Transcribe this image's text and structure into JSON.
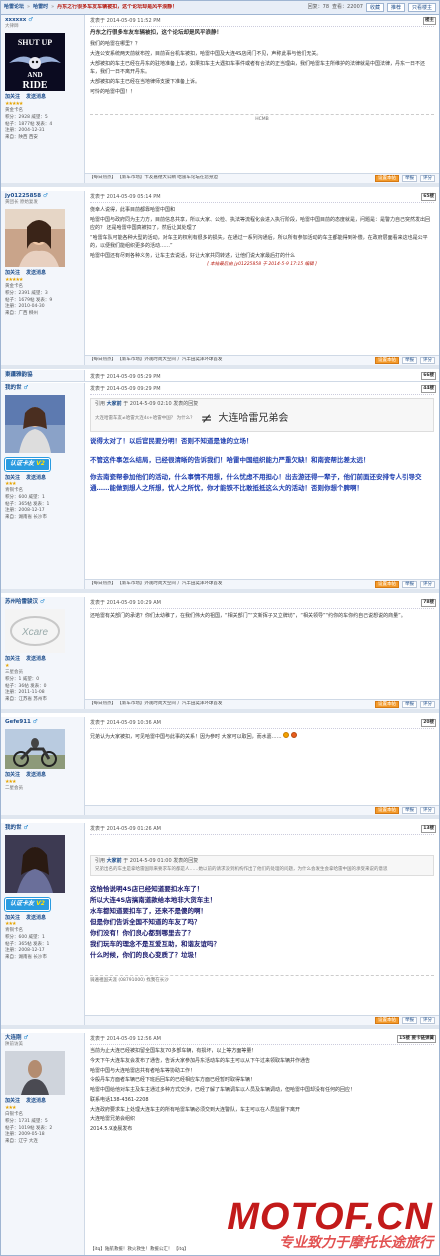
{
  "topbar": {
    "crumb1": "哈雷论坛",
    "crumb2": "哈雷时",
    "title": "丹东之行很多车友车辆被扣，这个论坛却是风平浪静！",
    "stat_label": "回复：",
    "stat_replies": "78",
    "stat_views_label": "查看：",
    "stat_views": "22007",
    "btn_prev": "收藏",
    "btn_next": "推荐",
    "btn_print": "只看楼主"
  },
  "posts": [
    {
      "user": "xxxxxx",
      "gender": "♂",
      "utitle": "大律師",
      "avatar_text": "SHUT UP AND RIDE",
      "actions": [
        "加关注",
        "发送消息"
      ],
      "stars": "★★★★★",
      "rank": "黄金卡名",
      "info": [
        "积分：2928 威望：5",
        "帖子：1877帖 发表：4",
        "注册：2004-12-31",
        "来自：陕西 西安"
      ],
      "date": "发表于 2014-05-09 11:52 PM",
      "floor": "楼主",
      "title": "丹东之行很多车友车辆被扣，这个论坛却是风平浪静！",
      "body": [
        "我们的哈雷在哪里？？",
        "大连公安系统两天前就布控，目前百台机车被扣，哈雷中国及大连4S店闭门不见，声称此事与他们无关。",
        "大部被扣的车主已经在丹东的驻地准备上访，如果扣车主大遇扣车事件或者有合法的正当理由，我们哈雷车主所维护的法律就是中国法律，丹东一日不还车，我们一日不离开丹东。",
        "大部被扣的车主已经在当地律师支援下准备上诉。",
        "可怜的哈雷中国！！"
      ],
      "sig": "HCMB",
      "footer_ad": "【每日热点】 【新车市场】卡友嘉德大公網 哈雷车论坛在您身边",
      "footer_btns": [
        "设置本帖",
        "举报",
        "评分"
      ]
    },
    {
      "user": "jy01225858",
      "gender": "♂",
      "utitle": "黄团长 原始复发",
      "avatar_text": "",
      "actions": [
        "加关注",
        "发送消息"
      ],
      "stars": "★★★★★",
      "rank": "黄金卡名",
      "info": [
        "积分：2391 威望：3",
        "帖子：1679帖 发表：9",
        "注册：2010-04-30",
        "来自：广西 柳州"
      ],
      "date": "发表于 2014-05-09 05:14 PM",
      "floor": "65楼",
      "title": "",
      "body": [
        "侥幸人说得，此事目前都靠哈雷中国和",
        "哈雷中国与政府同为主力方，目前信息共享，所以大家、公检、执法等流程化会进入执行阶段，哈雷中国目前的态度就是，问题是：是警力自己突然发出回应的？ 还是哈雷中国真被扣了，然后让其处理了",
        "“哈雷车队可能各种大型的活动，对车主的权利有很多的损失，在通过一系列沟通后，所以所有参加活动的车主都能得到补偿，在政府层面看来这也是公平的，以便我们能组织更多的活动……”",
        "哈雷中国还有尽到各种义务，让车主去说话，好让大家共同转述，让他们说大家最后打的什么"
      ],
      "edit": "[ 本帖最后由 jy01225858 于 2014-5-9 17:15 编辑 ]",
      "footer_ad": "【每日热点】 【新车市场】外观时尚大空间 广汽丰田奕泽环球首发",
      "footer_btns": [
        "设置本帖",
        "举报",
        "评分"
      ]
    },
    {
      "user": "東疆雅韵協",
      "gender": "",
      "utitle": "",
      "date": "发表于 2014-05-09 05:29 PM",
      "floor": "66楼",
      "collapsed": true
    },
    {
      "user": "我的世",
      "gender": "♂",
      "utitle": "",
      "avatar_text": "",
      "badge": "认证卡友",
      "badge_v": "V2",
      "actions": [
        "加关注",
        "发送消息"
      ],
      "stars": "★★★",
      "rank": "青铜卡名",
      "info": [
        "积分：600 威望：1",
        "帖子：365帖 发表：1",
        "注册：2008-12-17",
        "来自：湖南省 长沙市"
      ],
      "date": "发表于 2014-05-09 09:29 PM",
      "floor": "44楼",
      "quote_head": "大家前",
      "quote_date": "于 2014-5-09 02:10 发表的回复",
      "quote_small": "大连哈雷车友≠哈雷大连4s+哈雷中国？ 为什么？",
      "quote_big": "大连哈雷兄弟会",
      "body_blue": [
        "说得太对了！以后官民要分明！否则不知道是谁的立场！",
        "不管这件事怎么结局，已经很清晰的告诉我们！哈雷中国组织能力严重欠缺！和南瓷帮比差太远！",
        "你去南瓷帮参加他们的活动，什么事情不用想，什么忧虑不用担心！出去游还得一辈子，他们前面还安排专人引导交通……能做到想人之所想，忧人之所忧，你才能铁不比敢抵抵这么大的活动！否则你想个脾啊！"
      ],
      "footer_ad": "【每日热点】 【新车市场】外观时尚大空间 广汽丰田奕泽环球首发",
      "footer_btns": [
        "设置本帖",
        "举报",
        "评分"
      ]
    },
    {
      "user": "苏州哈雷骏汉",
      "gender": "♂",
      "utitle": "",
      "avatar_text": "Xcare",
      "actions": [
        "加关注",
        "发送消息"
      ],
      "stars": "★",
      "rank": "三星会员",
      "info": [
        "积分：1 威望：0",
        "帖子：36帖 发表：0",
        "注册：2011-11-08",
        "来自：江苏省 苏州市"
      ],
      "date": "发表于 2014-05-09 10:29 AM",
      "floor": "78楼",
      "title": "",
      "body": [
        "还哈雷有关部门的承诺？你们太幼稚了，在我们伟大的祖国，“相关部门”“文新挥子又立牌坊”，“相关领导”“约你的车你约自己说想说的商量”。"
      ],
      "footer_ad": "【每日热点】 【新车市场】外观时尚大空间 广汽丰田奕泽环球首发",
      "footer_btns": [
        "设置本帖",
        "举报",
        "评分"
      ]
    },
    {
      "user": "Gefe911",
      "gender": "♂",
      "utitle": "",
      "avatar_text": "",
      "actions": [
        "加关注",
        "发送消息"
      ],
      "stars": "★★★",
      "rank": "二星会员",
      "info": [],
      "date": "发表于 2014-05-09 10:36 AM",
      "floor": "20楼",
      "title": "",
      "body": [
        "兄弟认为大家被扣，可见哈雷中国与此事的关系！因为参时 大家可以取回，而水嘉……"
      ],
      "footer_ad": "",
      "footer_btns": [
        "设置本帖",
        "举报",
        "评分"
      ]
    },
    {
      "user": "我的世",
      "gender": "♂",
      "utitle": "",
      "avatar_text": "",
      "badge": "认证卡友",
      "badge_v": "V2",
      "actions": [
        "加关注",
        "发送消息"
      ],
      "stars": "★★★",
      "rank": "青铜卡名",
      "info": [
        "积分：600 威望：1",
        "帖子：365帖 发表：1",
        "注册：2008-12-17",
        "来自：湖南省 长沙市"
      ],
      "date": "发表于 2014-05-09 01:26 AM",
      "floor": "13楼",
      "quote_head": "大家前",
      "quote_date": "于 2014-5-09 01:00 发表的回复",
      "quote_small": "兄弟出名的车主是拿哈雷国际来要求车的都是人……她以前的请求没到机构作出了他们的处理的问题，为什么会发生会拿哈雷中国的承受来说的意思",
      "quote_big": "",
      "body_blue": [
        "这恰恰说明4S店已经知道要扣水车了！",
        "所以大连4S店搞南道款给本地非大货车主！",
        "水车都知道要扣车了，还来不是傻的啊！",
        "但是你们告诉全国不知道的车友了吗？",
        "你们没有！你们良心都到哪里去了？",
        "我们玩车的理念不是互爱互助，和谐友谊吗？",
        "什么时候，你们的良心变质了？垃圾！"
      ],
      "sig": "骑遍祖国天涯 (08791000) 找我在长沙",
      "footer_btns": [
        "设置本帖",
        "举报",
        "评分"
      ]
    },
    {
      "user": "大连刚",
      "gender": "♂",
      "utitle": "陕前访美",
      "avatar_text": "",
      "actions": [
        "加关注",
        "发送消息"
      ],
      "stars": "★★★",
      "rank": "白银卡名",
      "info": [
        "积分：1731 威望：5",
        "帖子：1019帖 发表：2",
        "注册：2009-05-18",
        "来自：辽宁 大连"
      ],
      "date": "发表于 2014-05-09 12:56 AM",
      "floor": "15楼 要卡链弹簧",
      "title": "",
      "body": [
        "当前为止大连已经被扣留全国车友70多部车辆，有损坏，以上等方面等量！",
        "今天下午大连车友会发布了通告，告诉大家参加丹东活动车的车主可以从下午过来领取车辆并作通告",
        "哈雷中国与大连哈雷店共有者哈车等协助工作！",
        "令般丹车方面者车辆已经下班后回车的已经相应车方面已经暂时取得车辆！",
        "哈雷中国给他对车主及车主通过多种方式交涉，已经了解了车辆调车以人员及车辆调动，但哈雷中国却没有任何的回应！",
        "联系电话138-4361-2208",
        "大连政府要求车上处理大连车主的所有哈雷车辆必须交到大连警队，车主可以在人员监督下离开",
        "大连哈雷兄弟会组织",
        "2014.5.9凌晨发布"
      ],
      "footer_ad": "【itq】陆航救援！救火救生！救援公汇！ 【itq】",
      "footer_btns": []
    }
  ],
  "watermark": {
    "logo": "MOTOF.CN",
    "slogan": "专业致力于摩托长途旅行"
  }
}
